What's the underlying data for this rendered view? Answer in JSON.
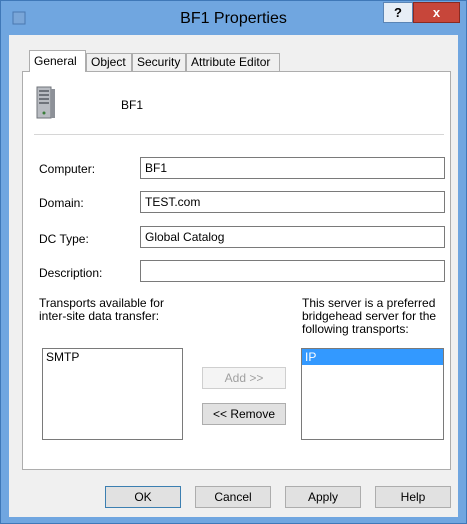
{
  "window": {
    "title": "BF1 Properties",
    "help_glyph": "?",
    "close_glyph": "x"
  },
  "tabs": [
    "General",
    "Object",
    "Security",
    "Attribute Editor"
  ],
  "general": {
    "server_name": "BF1",
    "computer_label": "Computer:",
    "computer_value": "BF1",
    "domain_label": "Domain:",
    "domain_value": "TEST.com",
    "dctype_label": "DC Type:",
    "dctype_value": "Global Catalog",
    "description_label": "Description:",
    "description_value": "",
    "transports_available_label_line1": "Transports available for",
    "transports_available_label_line2": "inter-site data transfer:",
    "preferred_label_line1": "This server is a preferred",
    "preferred_label_line2": "bridgehead server for the",
    "preferred_label_line3": "following transports:",
    "available_transports": [
      "SMTP"
    ],
    "preferred_transports": [
      "IP"
    ],
    "add_button": "Add >>",
    "remove_button": "<< Remove"
  },
  "footer": {
    "ok": "OK",
    "cancel": "Cancel",
    "apply": "Apply",
    "help": "Help"
  }
}
